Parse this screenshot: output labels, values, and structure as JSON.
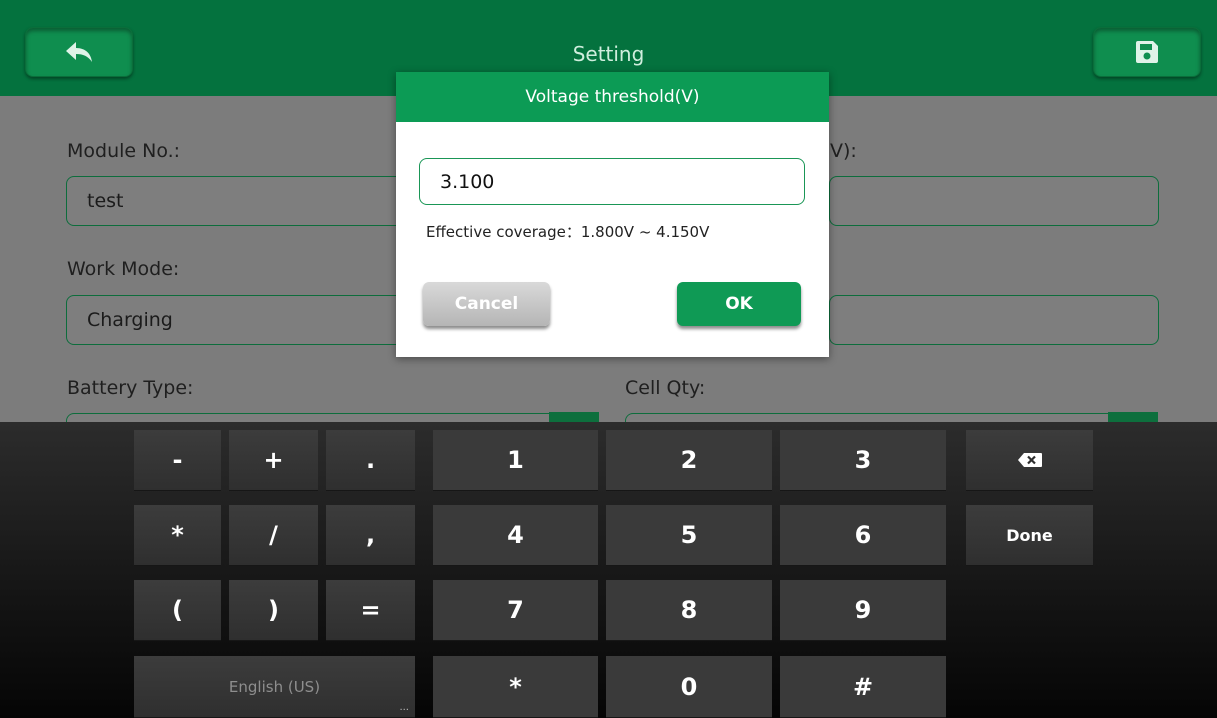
{
  "header": {
    "title": "Setting",
    "back_icon": "back-arrow-icon",
    "save_icon": "floppy-save-icon"
  },
  "form": {
    "module_label": "Module No.:",
    "module_value": "test",
    "right_label_partial": "V):",
    "work_mode_label": "Work Mode:",
    "work_mode_value": "Charging",
    "battery_type_label": "Battery Type:",
    "cell_qty_label": "Cell Qty:"
  },
  "dialog": {
    "title": "Voltage threshold(V)",
    "input_value": "3.100",
    "range_text": "Effective coverage：1.800V ~ 4.150V",
    "cancel_label": "Cancel",
    "ok_label": "OK"
  },
  "keyboard": {
    "row1": [
      "-",
      "+",
      ".",
      "1",
      "2",
      "3"
    ],
    "row2": [
      "*",
      "/",
      ",",
      "4",
      "5",
      "6"
    ],
    "row3": [
      "(",
      ")",
      "=",
      "7",
      "8",
      "9"
    ],
    "row4": [
      "*",
      "0",
      "#"
    ],
    "backspace_icon": "backspace-icon",
    "done_label": "Done",
    "language_label": "English (US)",
    "language_more": "..."
  },
  "colors": {
    "header_green": "#04723e",
    "dialog_green": "#0c9b55",
    "dim_background": "#7c7c7c"
  }
}
